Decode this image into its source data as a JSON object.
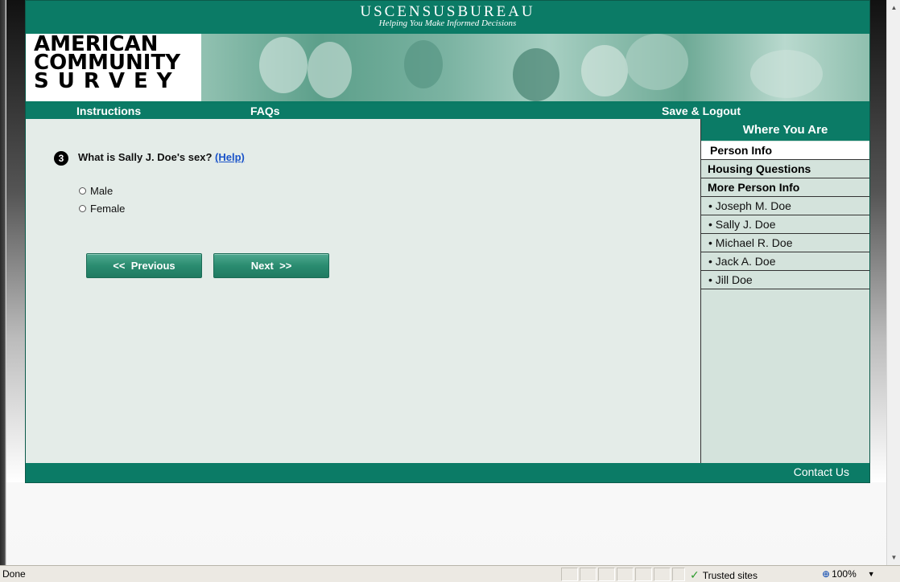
{
  "census": {
    "title": "USCENSUSBUREAU",
    "tagline": "Helping You Make Informed Decisions"
  },
  "logo": {
    "line1": "AMERICAN",
    "line2": "COMMUNITY",
    "line3": "SURVEY"
  },
  "nav": {
    "instructions": "Instructions",
    "faqs": "FAQs",
    "save_logout": "Save & Logout"
  },
  "question": {
    "number": "3",
    "text": "What is Sally J. Doe's sex?",
    "help": "(Help)",
    "options": [
      {
        "label": "Male",
        "selected": false
      },
      {
        "label": "Female",
        "selected": false
      }
    ]
  },
  "buttons": {
    "previous": "<<  Previous",
    "next": "Next  >>"
  },
  "sidebar": {
    "header": "Where You Are",
    "items": [
      {
        "label": "Person Info",
        "style": "current"
      },
      {
        "label": "Housing Questions",
        "style": "bold"
      },
      {
        "label": "More Person Info",
        "style": "bold"
      },
      {
        "label": "• Joseph M. Doe",
        "style": "sub"
      },
      {
        "label": "• Sally J. Doe",
        "style": "sub"
      },
      {
        "label": "• Michael R. Doe",
        "style": "sub"
      },
      {
        "label": "• Jack A. Doe",
        "style": "sub"
      },
      {
        "label": "• Jill Doe",
        "style": "sub"
      }
    ]
  },
  "footer": {
    "contact": "Contact Us"
  },
  "statusbar": {
    "status": "Done",
    "zone": "Trusted sites",
    "zoom": "100%"
  },
  "colors": {
    "brand_green": "#0b7b66",
    "link_blue": "#1a53c9"
  },
  "icons": {
    "question_badge": "number-3-circle-icon",
    "trusted": "check-icon",
    "zoom": "zoom-icon"
  }
}
